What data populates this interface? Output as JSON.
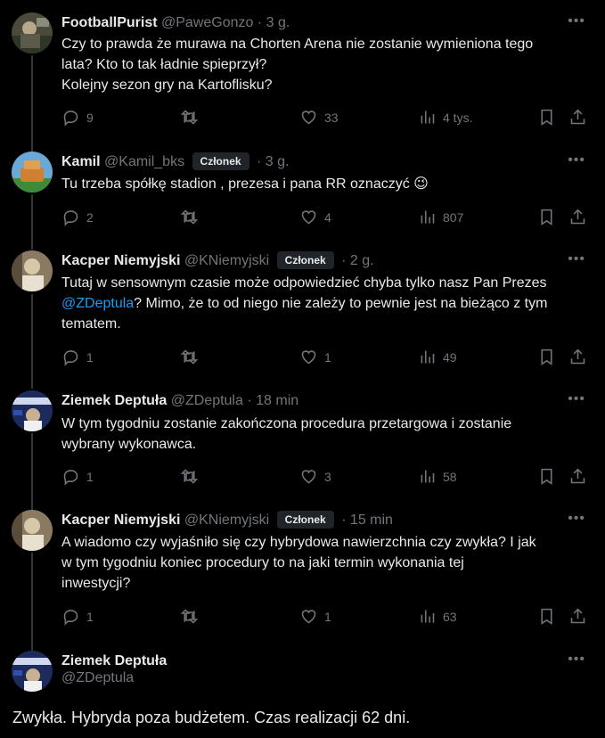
{
  "tweets": [
    {
      "name": "FootballPurist",
      "handle": "@PaweGonzo",
      "badge": "",
      "time": "3 g.",
      "lines": [
        "Czy to prawda że murawa na Chorten Arena nie zostanie wymieniona tego",
        "lata? Kto to tak ładnie spieprzył?",
        "Kolejny sezon gry na Kartoflisku?"
      ],
      "replies": "9",
      "retweets": "",
      "likes": "33",
      "views": "4 tys."
    },
    {
      "name": "Kamil",
      "handle": "@Kamil_bks",
      "badge": "Członek",
      "time": "3 g.",
      "lines": [
        "Tu trzeba spółkę stadion , prezesa i pana RR oznaczyć 😉"
      ],
      "replies": "2",
      "retweets": "",
      "likes": "4",
      "views": "807"
    },
    {
      "name": "Kacper Niemyjski",
      "handle": "@KNiemyjski",
      "badge": "Członek",
      "time": "2 g.",
      "line1": "Tutaj w sensownym czasie może odpowiedzieć chyba tylko nasz Pan Prezes",
      "mention": "@ZDeptula",
      "line2_rest": "? Mimo, że to od niego nie zależy to pewnie jest na bieżąco z tym",
      "line3": "tematem.",
      "replies": "1",
      "retweets": "",
      "likes": "1",
      "views": "49"
    },
    {
      "name": "Ziemek Deptuła",
      "handle": "@ZDeptula",
      "badge": "",
      "time": "18 min",
      "lines": [
        "W tym tygodniu zostanie zakończona procedura przetargowa i zostanie",
        "wybrany wykonawca."
      ],
      "replies": "1",
      "retweets": "",
      "likes": "3",
      "views": "58"
    },
    {
      "name": "Kacper Niemyjski",
      "handle": "@KNiemyjski",
      "badge": "Członek",
      "time": "15 min",
      "lines": [
        "A wiadomo czy wyjaśniło się czy hybrydowa nawierzchnia czy zwykła? I jak",
        "w tym tygodniu koniec procedury to na jaki termin wykonania tej",
        "inwestycji?"
      ],
      "replies": "1",
      "retweets": "",
      "likes": "1",
      "views": "63"
    }
  ],
  "main": {
    "name": "Ziemek Deptuła",
    "handle": "@ZDeptula",
    "text": "Zwykła. Hybryda poza budżetem. Czas realizacji 62 dni."
  },
  "separator": "·",
  "more_glyph": "•••"
}
